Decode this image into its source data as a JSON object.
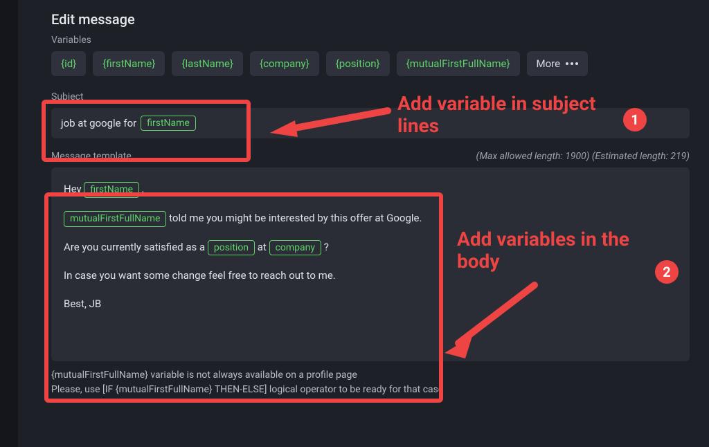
{
  "title": "Edit message",
  "variables_label": "Variables",
  "chips": [
    "{id}",
    "{firstName}",
    "{lastName}",
    "{company}",
    "{position}",
    "{mutualFirstFullName}"
  ],
  "more_label": "More",
  "subject": {
    "label": "Subject",
    "prefix": "job at google for",
    "token": "firstName"
  },
  "message": {
    "label": "Message template",
    "meta": "(Max allowed length: 1900) (Estimated length: 219)",
    "line1_prefix": "Hey",
    "line1_token": "firstName",
    "line1_suffix": ",",
    "line2_token": "mutualFirstFullName",
    "line2_rest": "told me you might be interested by this offer at Google.",
    "line3_a": "Are you currently satisfied as a",
    "line3_tok1": "position",
    "line3_b": "at",
    "line3_tok2": "company",
    "line3_c": "?",
    "line4": "In case you want some change feel free to reach out to me.",
    "line5": "Best, JB"
  },
  "footnote": {
    "l1": "{mutualFirstFullName} variable is not always available on a profile page",
    "l2": "Please, use [IF {mutualFirstFullName} THEN-ELSE] logical operator to be ready for that case"
  },
  "anno": {
    "callout1": "Add variable in subject lines",
    "callout2": "Add variables in the body",
    "badge1": "1",
    "badge2": "2"
  }
}
